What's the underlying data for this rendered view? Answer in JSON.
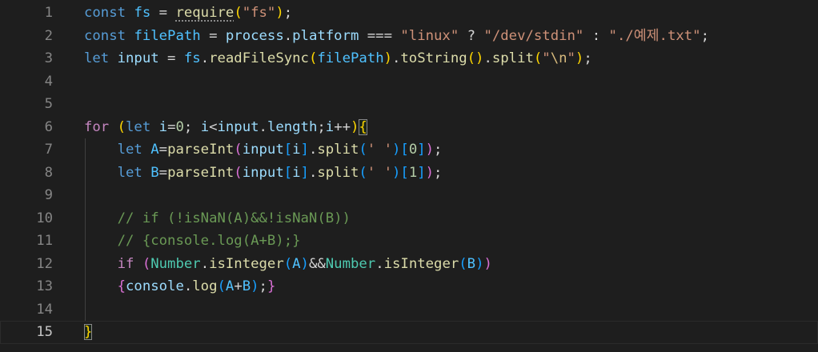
{
  "editor": {
    "colors": {
      "background": "#1e1e1e",
      "line_number": "#858585",
      "active_line_number": "#c6c6c6",
      "keyword": "#569cd6",
      "control": "#c586c0",
      "variable": "#9cdcfe",
      "constant": "#4fc1ff",
      "function": "#dcdcaa",
      "string": "#ce9178",
      "number": "#b5cea8",
      "class": "#4ec9b0",
      "comment": "#6a9955"
    },
    "active_line": 15,
    "lines": [
      {
        "n": "1",
        "tokens": [
          [
            "kw",
            "const"
          ],
          [
            "op",
            " "
          ],
          [
            "const",
            "fs"
          ],
          [
            "op",
            " = "
          ],
          [
            "fn hint",
            "require"
          ],
          [
            "b1",
            "("
          ],
          [
            "str",
            "\"fs\""
          ],
          [
            "b1",
            ")"
          ],
          [
            "op",
            ";"
          ]
        ]
      },
      {
        "n": "2",
        "tokens": [
          [
            "kw",
            "const"
          ],
          [
            "op",
            " "
          ],
          [
            "const",
            "filePath"
          ],
          [
            "op",
            " = "
          ],
          [
            "var",
            "process"
          ],
          [
            "op",
            "."
          ],
          [
            "var",
            "platform"
          ],
          [
            "op",
            " === "
          ],
          [
            "str",
            "\"linux\""
          ],
          [
            "op",
            " ? "
          ],
          [
            "str",
            "\"/dev/stdin\""
          ],
          [
            "op",
            " : "
          ],
          [
            "str",
            "\"./예제.txt\""
          ],
          [
            "op",
            ";"
          ]
        ]
      },
      {
        "n": "3",
        "tokens": [
          [
            "kw",
            "let"
          ],
          [
            "op",
            " "
          ],
          [
            "var",
            "input"
          ],
          [
            "op",
            " = "
          ],
          [
            "const",
            "fs"
          ],
          [
            "op",
            "."
          ],
          [
            "fn",
            "readFileSync"
          ],
          [
            "b1",
            "("
          ],
          [
            "const",
            "filePath"
          ],
          [
            "b1",
            ")"
          ],
          [
            "op",
            "."
          ],
          [
            "fn",
            "toString"
          ],
          [
            "b1",
            "()"
          ],
          [
            "op",
            "."
          ],
          [
            "fn",
            "split"
          ],
          [
            "b1",
            "("
          ],
          [
            "str",
            "\""
          ],
          [
            "esc",
            "\\n"
          ],
          [
            "str",
            "\""
          ],
          [
            "b1",
            ")"
          ],
          [
            "op",
            ";"
          ]
        ]
      },
      {
        "n": "4",
        "tokens": []
      },
      {
        "n": "5",
        "tokens": []
      },
      {
        "n": "6",
        "tokens": [
          [
            "ctl",
            "for"
          ],
          [
            "op",
            " "
          ],
          [
            "b1",
            "("
          ],
          [
            "kw",
            "let"
          ],
          [
            "op",
            " "
          ],
          [
            "var",
            "i"
          ],
          [
            "op",
            "="
          ],
          [
            "num",
            "0"
          ],
          [
            "op",
            "; "
          ],
          [
            "var",
            "i"
          ],
          [
            "op",
            "<"
          ],
          [
            "var",
            "input"
          ],
          [
            "op",
            "."
          ],
          [
            "var",
            "length"
          ],
          [
            "op",
            ";"
          ],
          [
            "var",
            "i"
          ],
          [
            "op",
            "++"
          ],
          [
            "b1",
            ")"
          ],
          [
            "b1 match",
            "{"
          ]
        ]
      },
      {
        "n": "7",
        "tokens": [
          [
            "op",
            "    "
          ],
          [
            "kw",
            "let"
          ],
          [
            "op",
            " "
          ],
          [
            "const",
            "A"
          ],
          [
            "op",
            "="
          ],
          [
            "fn",
            "parseInt"
          ],
          [
            "b2",
            "("
          ],
          [
            "var",
            "input"
          ],
          [
            "b3",
            "["
          ],
          [
            "var",
            "i"
          ],
          [
            "b3",
            "]"
          ],
          [
            "op",
            "."
          ],
          [
            "fn",
            "split"
          ],
          [
            "b3",
            "("
          ],
          [
            "str",
            "' '"
          ],
          [
            "b3",
            ")"
          ],
          [
            "b3",
            "["
          ],
          [
            "num",
            "0"
          ],
          [
            "b3",
            "]"
          ],
          [
            "b2",
            ")"
          ],
          [
            "op",
            ";"
          ]
        ]
      },
      {
        "n": "8",
        "tokens": [
          [
            "op",
            "    "
          ],
          [
            "kw",
            "let"
          ],
          [
            "op",
            " "
          ],
          [
            "const",
            "B"
          ],
          [
            "op",
            "="
          ],
          [
            "fn",
            "parseInt"
          ],
          [
            "b2",
            "("
          ],
          [
            "var",
            "input"
          ],
          [
            "b3",
            "["
          ],
          [
            "var",
            "i"
          ],
          [
            "b3",
            "]"
          ],
          [
            "op",
            "."
          ],
          [
            "fn",
            "split"
          ],
          [
            "b3",
            "("
          ],
          [
            "str",
            "' '"
          ],
          [
            "b3",
            ")"
          ],
          [
            "b3",
            "["
          ],
          [
            "num",
            "1"
          ],
          [
            "b3",
            "]"
          ],
          [
            "b2",
            ")"
          ],
          [
            "op",
            ";"
          ]
        ]
      },
      {
        "n": "9",
        "tokens": []
      },
      {
        "n": "10",
        "tokens": [
          [
            "op",
            "    "
          ],
          [
            "cmt",
            "// if (!isNaN(A)&&!isNaN(B))"
          ]
        ]
      },
      {
        "n": "11",
        "tokens": [
          [
            "op",
            "    "
          ],
          [
            "cmt",
            "// {console.log(A+B);}"
          ]
        ]
      },
      {
        "n": "12",
        "tokens": [
          [
            "op",
            "    "
          ],
          [
            "ctl",
            "if"
          ],
          [
            "op",
            " "
          ],
          [
            "b2",
            "("
          ],
          [
            "cls",
            "Number"
          ],
          [
            "op",
            "."
          ],
          [
            "fn",
            "isInteger"
          ],
          [
            "b3",
            "("
          ],
          [
            "const",
            "A"
          ],
          [
            "b3",
            ")"
          ],
          [
            "op",
            "&&"
          ],
          [
            "cls",
            "Number"
          ],
          [
            "op",
            "."
          ],
          [
            "fn",
            "isInteger"
          ],
          [
            "b3",
            "("
          ],
          [
            "const",
            "B"
          ],
          [
            "b3",
            ")"
          ],
          [
            "b2",
            ")"
          ]
        ]
      },
      {
        "n": "13",
        "tokens": [
          [
            "op",
            "    "
          ],
          [
            "b2",
            "{"
          ],
          [
            "var",
            "console"
          ],
          [
            "op",
            "."
          ],
          [
            "fn",
            "log"
          ],
          [
            "b3",
            "("
          ],
          [
            "const",
            "A"
          ],
          [
            "op",
            "+"
          ],
          [
            "const",
            "B"
          ],
          [
            "b3",
            ")"
          ],
          [
            "op",
            ";"
          ],
          [
            "b2",
            "}"
          ]
        ]
      },
      {
        "n": "14",
        "tokens": []
      },
      {
        "n": "15",
        "tokens": [
          [
            "b1 match",
            "}"
          ]
        ]
      }
    ]
  }
}
